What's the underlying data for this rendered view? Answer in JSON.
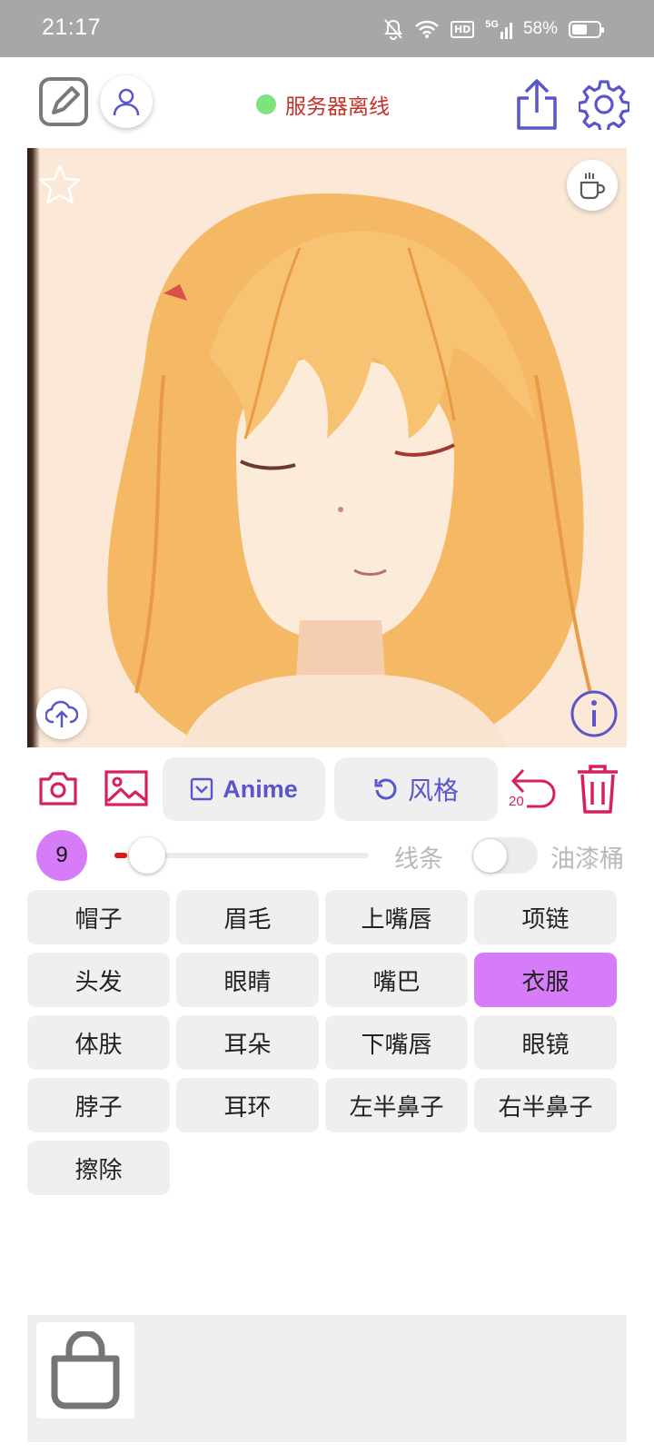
{
  "status_bar": {
    "time": "21:17",
    "network": "5G",
    "hd": "HD",
    "battery_percent": "58%",
    "battery_level": 0.58
  },
  "header": {
    "server_status": "服务器离线",
    "server_status_color": "#7ee37e"
  },
  "toolbar": {
    "anime_label": "Anime",
    "style_label": "风格",
    "undo_count": "20"
  },
  "brush": {
    "size": "9",
    "slider_value": 0.05,
    "mode_lines": "线条",
    "mode_bucket": "油漆桶",
    "bucket_enabled": false
  },
  "labels": [
    {
      "text": "帽子",
      "active": false
    },
    {
      "text": "眉毛",
      "active": false
    },
    {
      "text": "上嘴唇",
      "active": false
    },
    {
      "text": "项链",
      "active": false
    },
    {
      "text": "头发",
      "active": false
    },
    {
      "text": "眼睛",
      "active": false
    },
    {
      "text": "嘴巴",
      "active": false
    },
    {
      "text": "衣服",
      "active": true
    },
    {
      "text": "体肤",
      "active": false
    },
    {
      "text": "耳朵",
      "active": false
    },
    {
      "text": "下嘴唇",
      "active": false
    },
    {
      "text": "眼镜",
      "active": false
    },
    {
      "text": "脖子",
      "active": false
    },
    {
      "text": "耳环",
      "active": false
    },
    {
      "text": "左半鼻子",
      "active": false
    },
    {
      "text": "右半鼻子",
      "active": false
    },
    {
      "text": "擦除",
      "active": false
    }
  ],
  "colors": {
    "accent_pink": "#d5215d",
    "accent_indigo": "#5956c9",
    "active_label": "#d77cf8"
  },
  "icons": {
    "edit": "edit-square-icon",
    "user": "user-icon",
    "share": "share-icon",
    "settings": "gear-icon",
    "favorite": "star-icon",
    "coffee": "coffee-cup-icon",
    "upload": "cloud-upload-icon",
    "info": "info-icon",
    "camera": "camera-icon",
    "gallery": "image-icon",
    "undo": "undo-icon",
    "delete": "trash-icon",
    "bag": "shopping-bag-icon"
  }
}
